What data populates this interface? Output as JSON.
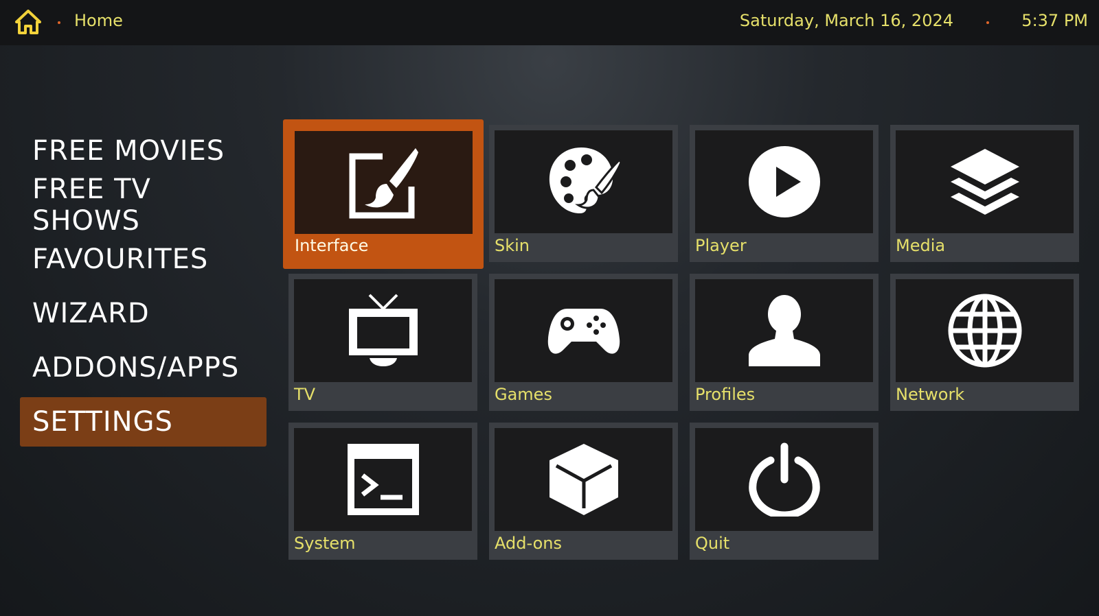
{
  "topbar": {
    "breadcrumb": "Home",
    "date": "Saturday, March 16, 2024",
    "time": "5:37 PM",
    "accent": "#e6e06a",
    "dot_color": "#e0662a"
  },
  "sidebar": {
    "items": [
      {
        "label": "FREE MOVIES"
      },
      {
        "label": "FREE TV SHOWS"
      },
      {
        "label": "FAVOURITES"
      },
      {
        "label": "WIZARD"
      },
      {
        "label": "ADDONS/APPS"
      },
      {
        "label": "SETTINGS",
        "selected": true
      }
    ],
    "selected_color": "#7b3e16"
  },
  "tiles": [
    {
      "label": "Interface",
      "icon": "paintbrush-icon",
      "selected": true
    },
    {
      "label": "Skin",
      "icon": "palette-icon"
    },
    {
      "label": "Player",
      "icon": "play-icon"
    },
    {
      "label": "Media",
      "icon": "layers-icon"
    },
    {
      "label": "TV",
      "icon": "tv-icon"
    },
    {
      "label": "Games",
      "icon": "gamepad-icon"
    },
    {
      "label": "Profiles",
      "icon": "user-icon"
    },
    {
      "label": "Network",
      "icon": "globe-icon"
    },
    {
      "label": "System",
      "icon": "terminal-icon"
    },
    {
      "label": "Add-ons",
      "icon": "box-icon"
    },
    {
      "label": "Quit",
      "icon": "power-icon"
    }
  ],
  "selected_tile_color": "#c25412"
}
